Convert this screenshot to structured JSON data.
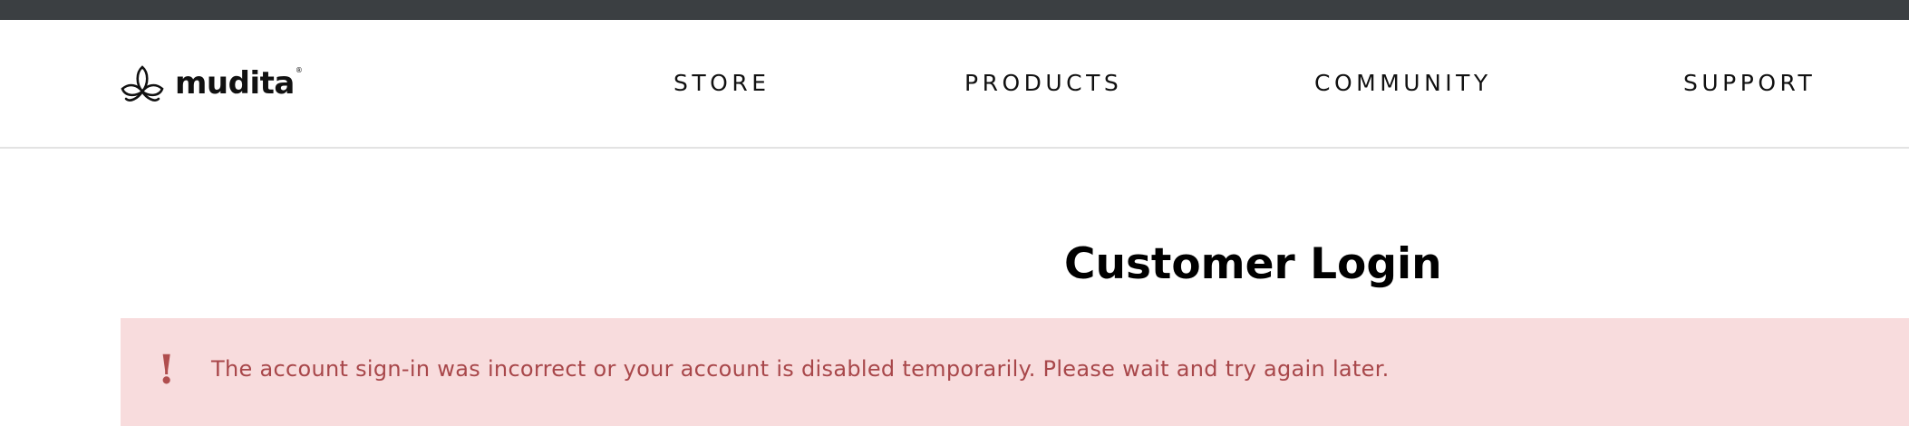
{
  "brand": {
    "name": "mudita",
    "reg_mark": "®"
  },
  "nav": {
    "items": [
      {
        "label": "STORE"
      },
      {
        "label": "PRODUCTS"
      },
      {
        "label": "COMMUNITY"
      },
      {
        "label": "SUPPORT"
      }
    ]
  },
  "page": {
    "title": "Customer Login"
  },
  "alert": {
    "icon": "!",
    "message": "The account sign-in was incorrect or your account is disabled temporarily. Please wait and try again later."
  },
  "colors": {
    "topbar": "#3b3f42",
    "alert_background": "#f8dcdd",
    "alert_text": "#a8474a"
  }
}
